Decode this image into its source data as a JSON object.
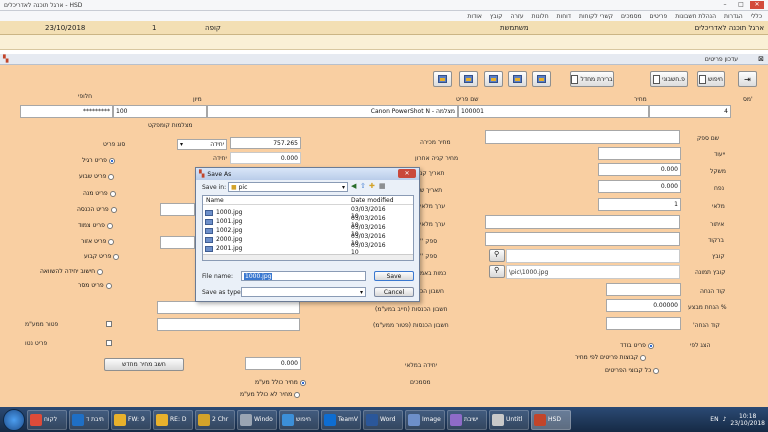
{
  "app": {
    "title": "ארגל תוכנה לאדריכלים - HSD",
    "menu": [
      "כללי",
      "הגדרות",
      "הנהלת חשבונות",
      "פריטים",
      "מסמכים",
      "קשרי לקוחות",
      "דוחות",
      "חלונות",
      "עזרה",
      "קובץ",
      "אודות"
    ]
  },
  "status": {
    "date": "23/10/2018",
    "cash_label": "קופה",
    "cash_value": "1",
    "user_label": "משתמשת",
    "company": "ארגל תוכנה לאדריכלים"
  },
  "window": {
    "title": "עדכון פריטים"
  },
  "toolbar": {
    "search_label": "חיפוש",
    "new_label": "פ.חשבוני",
    "barcode_label": "ברירת מחדל"
  },
  "form": {
    "col_number": "מס'",
    "col_price": "מחיר",
    "col_name": "שם פריט",
    "col_model": "מיון",
    "col_spare": "חלופי",
    "number_value": "4",
    "name_value": "Canon PowerShot N - מצלמה",
    "code_value": "100001",
    "model_value": "100",
    "spare_value": "*********",
    "group_label": "מצלמות קומפקט",
    "supplier_code_label": "שם ספק",
    "weight_label": "משקל",
    "volume_label": "נפח",
    "stock_label": "מלאי",
    "barcode_label": "ברקוד",
    "file_label": "קובץ",
    "image_label": "קובץ תמונה",
    "reorder_label": "קוד הנחה",
    "discount_pct_label": "% הנחת מבצע",
    "reorder2_label": "קוד הנחה'",
    "show_label": "הצג לפי",
    "weight_value": "0.000",
    "volume_value": "0.000",
    "stock_value": "1",
    "discount_value": "0.00000",
    "image_value": "\\pic\\1000.jpg",
    "price_value": "757.265",
    "price_unit": "יחידה",
    "purchase_price_label": "מחיר מכירה",
    "last_purchase_label": "מחיר קניה אחרון",
    "price_value2": "0.000",
    "type_label": "סוג פריט",
    "types": [
      "פריט רגיל",
      "פריט שבוע",
      "פריט מנה",
      "פריט הכנסה",
      "פריט צמוד",
      "פריט אזור",
      "פריט קבוע",
      "חישוב יחידה להשוואה",
      "פריט מסר"
    ],
    "acct_income_label": "חשבון הכנסות (חייב במע\"מ)",
    "acct_income_free_label": "חשבון הכנסות (פטור ממע\"מ)",
    "vat_exempt_label": "פטור ממע\"מ",
    "vat_excluded_label": "פריט נטו",
    "units_label": "יחידה במלאי",
    "units_value": "0.000",
    "calc_button": "חשב מחיר מחדש",
    "price_with_vat": "מחיר כולל מע\"מ",
    "price_without_vat": "מחיר לא כולל מע\"מ",
    "doc_label": "מסמכים",
    "radio_by_item": "פריט בודד",
    "radio_by_group": "קבוצות פריטים לפי מחיר",
    "radio_all": "כל קבוצי הפריטים"
  },
  "dialog": {
    "title": "Save As",
    "save_in_label": "Save in:",
    "save_in_value": "pic",
    "col_name": "Name",
    "col_date": "Date modified",
    "files": [
      {
        "name": "1000.jpg",
        "date": "03/03/2016 10"
      },
      {
        "name": "1001.jpg",
        "date": "03/03/2016 10"
      },
      {
        "name": "1002.jpg",
        "date": "03/03/2016 10"
      },
      {
        "name": "2000.jpg",
        "date": "03/03/2016 10"
      },
      {
        "name": "2001.jpg",
        "date": "03/03/2016 10"
      }
    ],
    "filename_label": "File name:",
    "filename_value": "1000.jpg",
    "savetype_label": "Save as type:",
    "save_button": "Save",
    "cancel_button": "Cancel"
  },
  "taskbar": {
    "tasks": [
      "לקוח",
      "תיבת ד",
      "FW: 9",
      "RE: D",
      "2 Chr",
      "Windo",
      "חיפוש",
      "TeamV",
      "Word",
      "Image",
      "ישיבת",
      "Untitl",
      "HSD"
    ],
    "lang": "EN",
    "time": "10:18",
    "date": "23/10/2018"
  }
}
